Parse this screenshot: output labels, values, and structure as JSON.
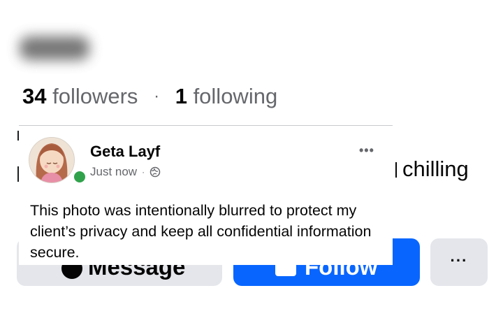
{
  "profile": {
    "followers_count": "34",
    "followers_label": "followers",
    "separator": "·",
    "following_count": "1",
    "following_label": "following",
    "bio_fragment": "chilling"
  },
  "actions": {
    "message_label": "Message",
    "follow_label": "Follow",
    "more_label": "···"
  },
  "post": {
    "author": "Geta Layf",
    "time": "Just now",
    "meta_separator": "·",
    "more_label": "•••",
    "text": "This photo was intentionally blurred to protect my client’s privacy and keep all confidential information secure.",
    "privacy_icon": "globe-icon"
  },
  "colors": {
    "follow_blue": "#0866ff",
    "secondary_button": "#e4e6eb",
    "muted_text": "#65676b",
    "online_green": "#31a24c"
  }
}
